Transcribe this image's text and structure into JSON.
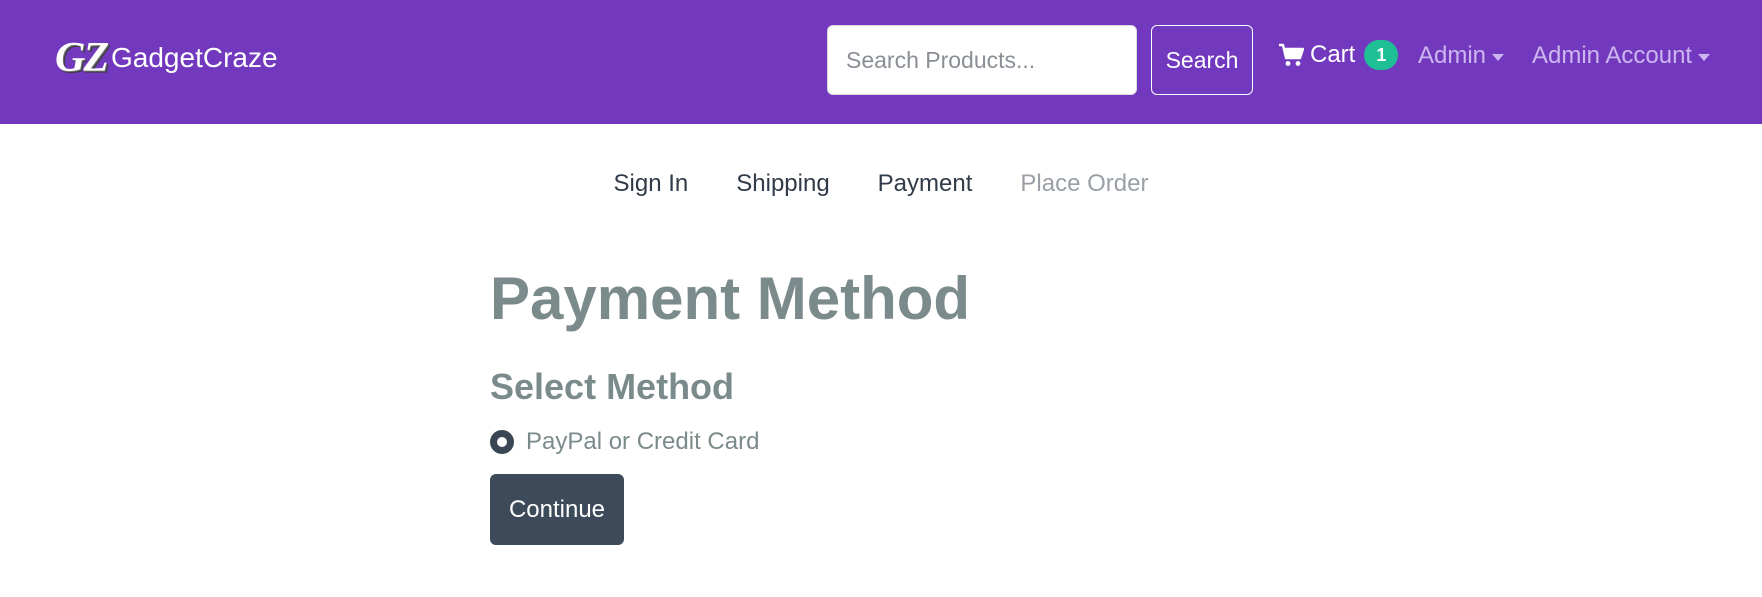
{
  "navbar": {
    "brand_logo": "GZ",
    "brand_name": "GadgetCraze",
    "search_placeholder": "Search Products...",
    "search_button": "Search",
    "cart_label": "Cart",
    "cart_count": "1",
    "admin_menu": "Admin",
    "account_menu": "Admin Account",
    "colors": {
      "background": "#7239bf",
      "badge": "#1fbf95"
    }
  },
  "checkout_steps": [
    {
      "label": "Sign In",
      "enabled": true
    },
    {
      "label": "Shipping",
      "enabled": true
    },
    {
      "label": "Payment",
      "enabled": true
    },
    {
      "label": "Place Order",
      "enabled": false
    }
  ],
  "main": {
    "title": "Payment Method",
    "section_title": "Select Method",
    "payment_option": {
      "label": "PayPal or Credit Card",
      "selected": true
    },
    "continue_button": "Continue"
  },
  "icons": {
    "cart": "shopping-cart-icon",
    "caret": "chevron-down-icon"
  }
}
